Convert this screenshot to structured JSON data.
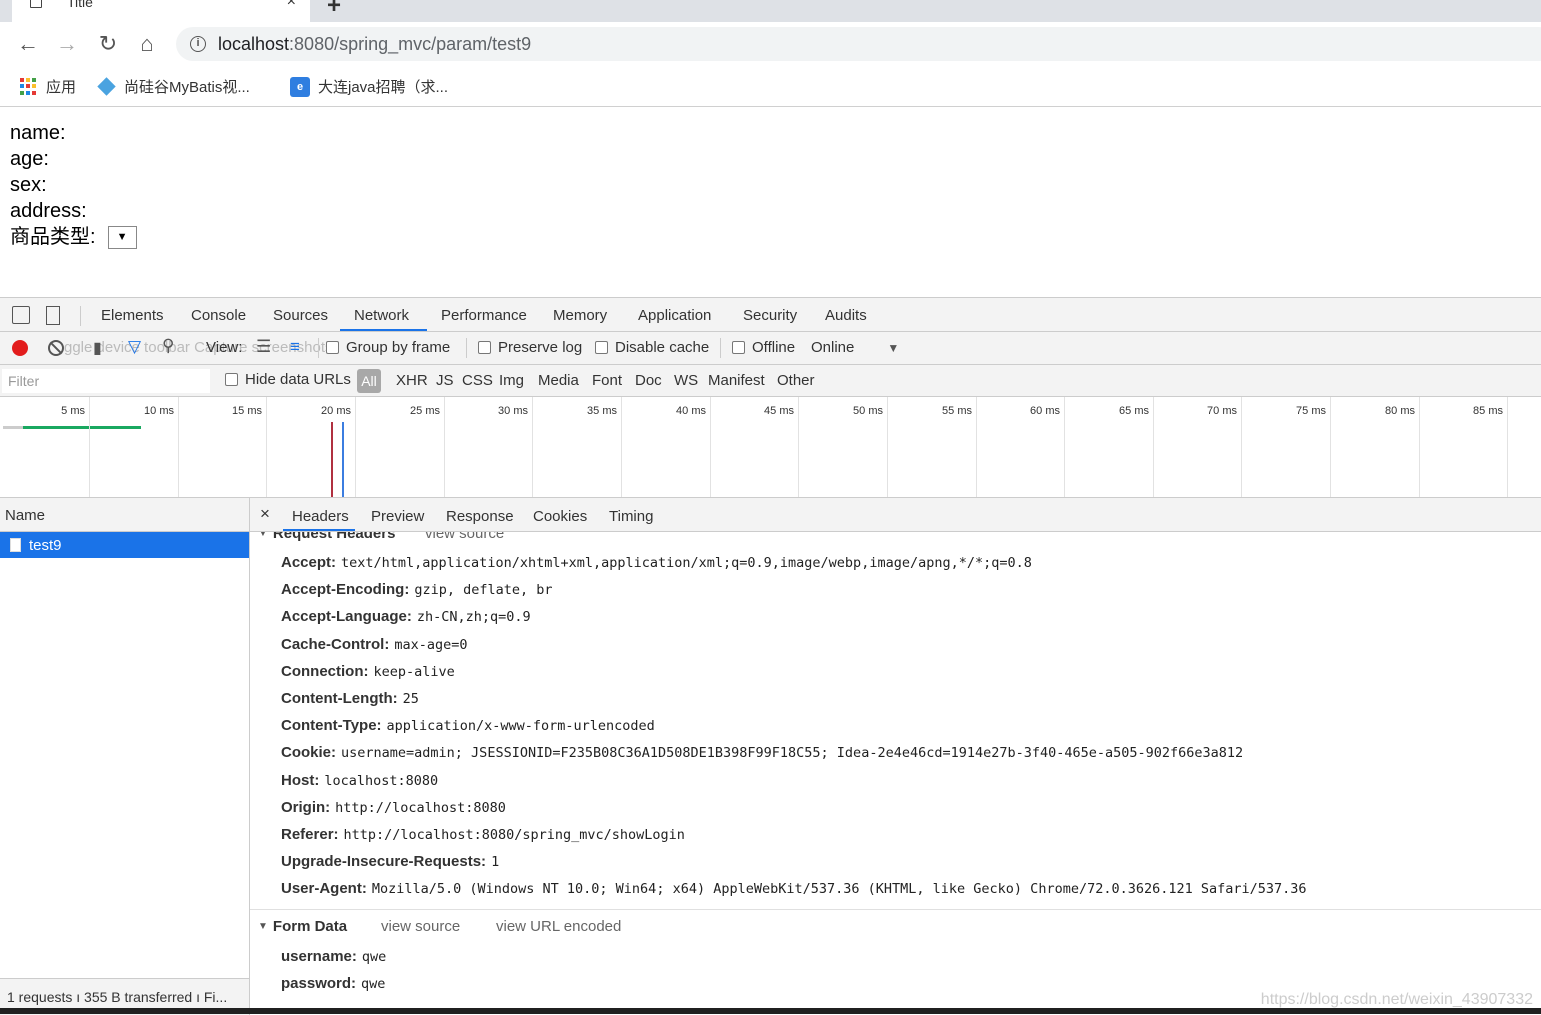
{
  "browser": {
    "tab_title": "Title",
    "tab_close": "×",
    "new_tab": "+",
    "url_host": "localhost",
    "url_path": ":8080/spring_mvc/param/test9",
    "bookmarks": [
      {
        "label": "应用",
        "icon": "apps-icon"
      },
      {
        "label": "尚硅谷MyBatis视...",
        "icon": "gem-icon"
      },
      {
        "label": "大连java招聘（求...",
        "icon": "blue-icon"
      }
    ]
  },
  "page": {
    "fields": [
      "name:",
      "age:",
      "sex:",
      "address:"
    ],
    "select_label": "商品类型:",
    "select_arrow": "▼"
  },
  "devtools": {
    "tabs": [
      "Elements",
      "Console",
      "Sources",
      "Network",
      "Performance",
      "Memory",
      "Application",
      "Security",
      "Audits"
    ],
    "active_tab": "Network",
    "toolbar": {
      "ghost_text": "ggle device toolbar  Capture screenshots",
      "view_label": "View:",
      "group_by_frame": "Group by frame",
      "preserve_log": "Preserve log",
      "disable_cache": "Disable cache",
      "offline": "Offline",
      "throttle": "Online",
      "throttle_arrow": "▼"
    },
    "filter": {
      "placeholder": "Filter",
      "hide_data_urls": "Hide data URLs",
      "all": "All",
      "types": [
        "XHR",
        "JS",
        "CSS",
        "Img",
        "Media",
        "Font",
        "Doc",
        "WS",
        "Manifest",
        "Other"
      ]
    },
    "timeline_ticks": [
      "5 ms",
      "10 ms",
      "15 ms",
      "20 ms",
      "25 ms",
      "30 ms",
      "35 ms",
      "40 ms",
      "45 ms",
      "50 ms",
      "55 ms",
      "60 ms",
      "65 ms",
      "70 ms",
      "75 ms",
      "80 ms",
      "85 ms"
    ],
    "name_header": "Name",
    "request_name": "test9",
    "status": "1 requests  ı  355 B transferred  ı  Fi...",
    "detail_tabs": [
      "Headers",
      "Preview",
      "Response",
      "Cookies",
      "Timing"
    ],
    "detail_close": "×",
    "request_headers_title": "Request Headers",
    "request_view_source": "view source",
    "request_headers": [
      {
        "k": "Accept:",
        "v": "text/html,application/xhtml+xml,application/xml;q=0.9,image/webp,image/apng,*/*;q=0.8"
      },
      {
        "k": "Accept-Encoding:",
        "v": "gzip, deflate, br"
      },
      {
        "k": "Accept-Language:",
        "v": "zh-CN,zh;q=0.9"
      },
      {
        "k": "Cache-Control:",
        "v": "max-age=0"
      },
      {
        "k": "Connection:",
        "v": "keep-alive"
      },
      {
        "k": "Content-Length:",
        "v": "25"
      },
      {
        "k": "Content-Type:",
        "v": "application/x-www-form-urlencoded"
      },
      {
        "k": "Cookie:",
        "v": "username=admin; JSESSIONID=F235B08C36A1D508DE1B398F99F18C55; Idea-2e4e46cd=1914e27b-3f40-465e-a505-902f66e3a812"
      },
      {
        "k": "Host:",
        "v": "localhost:8080"
      },
      {
        "k": "Origin:",
        "v": "http://localhost:8080"
      },
      {
        "k": "Referer:",
        "v": "http://localhost:8080/spring_mvc/showLogin"
      },
      {
        "k": "Upgrade-Insecure-Requests:",
        "v": "1"
      },
      {
        "k": "User-Agent:",
        "v": "Mozilla/5.0 (Windows NT 10.0; Win64; x64) AppleWebKit/537.36 (KHTML, like Gecko) Chrome/72.0.3626.121 Safari/537.36"
      }
    ],
    "form_data_title": "Form Data",
    "form_view_source": "view source",
    "form_view_url_encoded": "view URL encoded",
    "form_data": [
      {
        "k": "username:",
        "v": "qwe"
      },
      {
        "k": "password:",
        "v": "qwe"
      }
    ]
  },
  "watermark": "https://blog.csdn.net/weixin_43907332"
}
